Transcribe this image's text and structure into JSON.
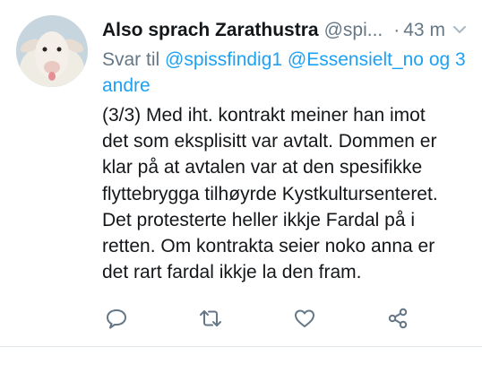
{
  "tweet": {
    "display_name": "Also sprach Zarathustra",
    "handle": "@spi...",
    "separator": "·",
    "time": "43 m",
    "reply_prefix": "Svar til",
    "reply_mentions": [
      "@spissfindig1",
      "@Essensielt_no",
      "og",
      "3 andre"
    ],
    "text_lines": [
      "(3/3) Med iht. kontrakt meiner han imot",
      "det som eksplisitt var avtalt. Dommen er",
      "klar på at avtalen var at den spesifikke",
      "flyttebrygga tilhøyrde Kystkultursenteret.",
      "Det protesterte heller ikkje Fardal på i",
      "retten. Om kontrakta seier noko anna er",
      "det rart fardal ikkje la den fram."
    ]
  },
  "icons": {
    "menu": "chevron-down-icon",
    "reply": "reply-icon",
    "retweet": "retweet-icon",
    "like": "heart-icon",
    "share": "share-icon"
  },
  "colors": {
    "link": "#1da1f2",
    "secondary_text": "#657786",
    "primary_text": "#14171a",
    "icon": "#657786"
  }
}
